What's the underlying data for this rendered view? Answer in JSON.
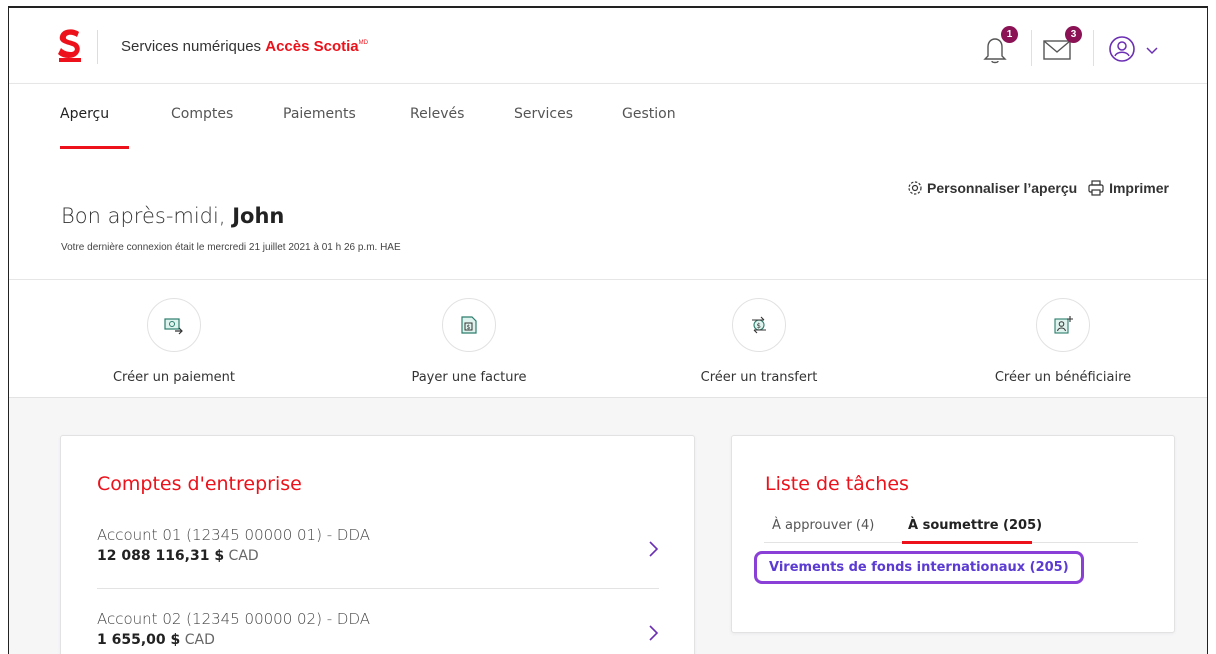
{
  "header": {
    "brand_prefix": "Services numériques ",
    "brand_name": "Accès Scotia",
    "brand_mark": "MD",
    "notifications_count": "1",
    "messages_count": "3"
  },
  "nav": {
    "items": [
      {
        "label": "Aperçu"
      },
      {
        "label": "Comptes"
      },
      {
        "label": "Paiements"
      },
      {
        "label": "Relevés"
      },
      {
        "label": "Services"
      },
      {
        "label": "Gestion"
      }
    ]
  },
  "greeting": {
    "prefix": "Bon après-midi, ",
    "name": "John",
    "last_login": "Votre dernière connexion était le mercredi 21 juillet 2021 à 01 h 26 p.m. HAE",
    "customize_label": "Personnaliser l’aperçu",
    "print_label": "Imprimer"
  },
  "quick_actions": [
    {
      "label": "Créer un paiement",
      "icon": "payment-icon"
    },
    {
      "label": "Payer une facture",
      "icon": "bill-icon"
    },
    {
      "label": "Créer un transfert",
      "icon": "transfer-icon"
    },
    {
      "label": "Créer un bénéficiaire",
      "icon": "add-payee-icon"
    }
  ],
  "accounts": {
    "title": "Comptes d'entreprise",
    "items": [
      {
        "name": "Account 01 (12345 00000 01) - DDA",
        "balance": "12 088 116,31 $",
        "currency": "CAD"
      },
      {
        "name": "Account 02 (12345 00000 02) - DDA",
        "balance": "1 655,00 $",
        "currency": "CAD"
      }
    ]
  },
  "tasks": {
    "title": "Liste de tâches",
    "tabs": [
      {
        "label": "À approuver (4)"
      },
      {
        "label": "À soumettre (205)"
      }
    ],
    "link": "Virements de fonds internationaux (205)"
  },
  "colors": {
    "brand_red": "#ec111a",
    "badge_purple": "#8a1255",
    "highlight_purple": "#8a3fd6"
  }
}
